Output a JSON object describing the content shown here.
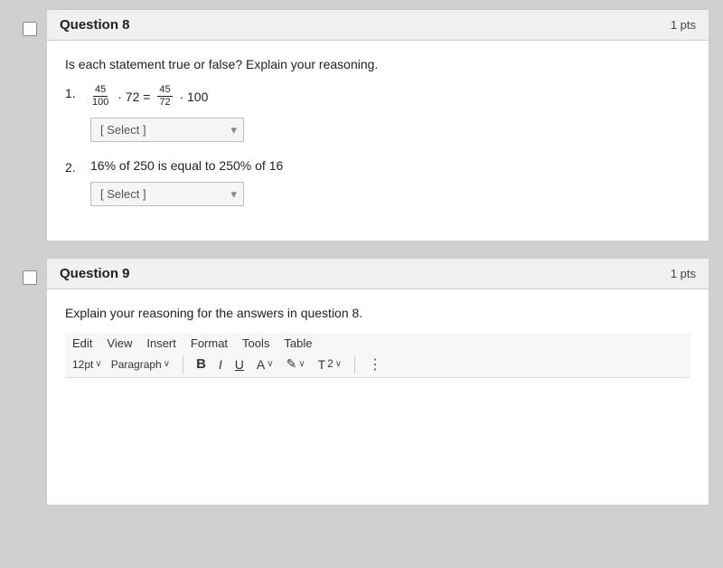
{
  "questions": [
    {
      "id": "question-8",
      "title": "Question 8",
      "pts": "1 pts",
      "type": "true-false",
      "intro": "Is each statement true or false? Explain your reasoning.",
      "items": [
        {
          "num": "1.",
          "mathHtml": true,
          "text": "",
          "select_placeholder": "[ Select ]"
        },
        {
          "num": "2.",
          "mathHtml": false,
          "text": "16% of 250 is equal to 250% of 16",
          "select_placeholder": "[ Select ]"
        }
      ]
    },
    {
      "id": "question-9",
      "title": "Question 9",
      "pts": "1 pts",
      "type": "editor",
      "intro": "Explain your reasoning for the answers in question 8.",
      "toolbar": {
        "menu": [
          "Edit",
          "View",
          "Insert",
          "Format",
          "Tools",
          "Table"
        ],
        "size": "12pt",
        "para": "Paragraph"
      }
    }
  ]
}
